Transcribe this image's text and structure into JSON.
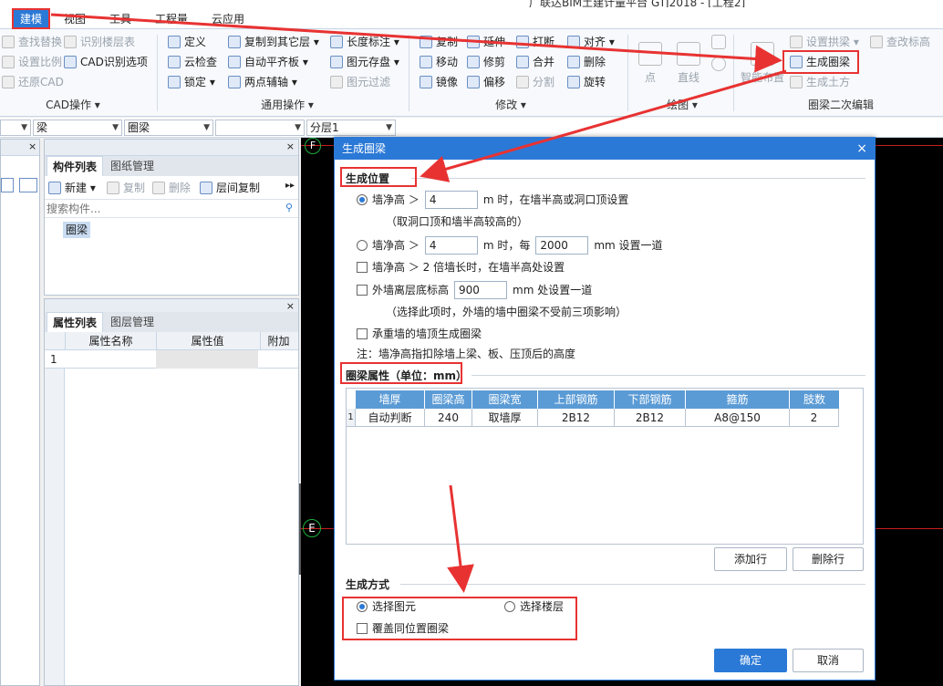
{
  "app": {
    "title": "广联达BIM土建计量平台 GTJ2018 - [工程2]"
  },
  "menu": {
    "items": [
      "建模",
      "视图",
      "工具",
      "工程量",
      "云应用"
    ]
  },
  "ribbon": {
    "cad": {
      "items": [
        "查找替换",
        "识别楼层表",
        "设置比例",
        "CAD识别选项",
        "还原CAD"
      ],
      "group": "CAD操作 ▾"
    },
    "common": {
      "items": [
        "定义",
        "复制到其它层 ▾",
        "长度标注 ▾",
        "云检查",
        "自动平齐板 ▾",
        "图元存盘 ▾",
        "锁定 ▾",
        "两点辅轴 ▾",
        "图元过滤"
      ],
      "group": "通用操作 ▾"
    },
    "modify": {
      "items": [
        "复制",
        "延伸",
        "打断",
        "对齐 ▾",
        "移动",
        "修剪",
        "合并",
        "删除",
        "镜像",
        "偏移",
        "分割",
        "旋转"
      ],
      "group": "修改 ▾"
    },
    "draw": {
      "items": [
        "点",
        "直线"
      ],
      "group": "绘图 ▾"
    },
    "ringbeam": {
      "items": [
        "智能布置",
        "设置拱梁 ▾",
        "查改标高",
        "生成圈梁",
        "生成土方"
      ],
      "group": "圈梁二次编辑"
    }
  },
  "combos": [
    "",
    "梁",
    "圈梁",
    "",
    "分层1"
  ],
  "left": {
    "comp_tabs": [
      "构件列表",
      "图纸管理"
    ],
    "comp_toolbar": [
      "新建 ▾",
      "复制",
      "删除",
      "层间复制"
    ],
    "search_placeholder": "搜索构件...",
    "comp_item": "圈梁",
    "prop_tabs": [
      "属性列表",
      "图层管理"
    ],
    "prop_headers": [
      "属性名称",
      "属性值",
      "附加"
    ],
    "prop_row_no": "1"
  },
  "canvas": {
    "axis_f": "F",
    "axis_e": "E"
  },
  "dialog": {
    "title": "生成圈梁",
    "close": "×",
    "position": {
      "section": "生成位置",
      "opt1_a": "墙净高 ＞",
      "opt1_value": "4",
      "opt1_b": "m 时，在墙半高或洞口顶设置",
      "opt1_note": "（取洞口顶和墙半高较高的）",
      "opt2_a": "墙净高 ＞",
      "opt2_value": "4",
      "opt2_b": "m 时，每",
      "opt2_value2": "2000",
      "opt2_c": "mm 设置一道",
      "opt3": "墙净高 ＞ 2 倍墙长时，在墙半高处设置",
      "opt4_a": "外墙离层底标高",
      "opt4_value": "900",
      "opt4_b": "mm 处设置一道",
      "opt4_note": "（选择此项时，外墙的墙中圈梁不受前三项影响）",
      "opt5": "承重墙的墙顶生成圈梁",
      "note": "注：墙净高指扣除墙上梁、板、压顶后的高度"
    },
    "props": {
      "section": "圈梁属性（单位：mm）",
      "headers": [
        "墙厚",
        "圈梁高",
        "圈梁宽",
        "上部钢筋",
        "下部钢筋",
        "箍筋",
        "肢数"
      ],
      "row_no": "1",
      "row": [
        "自动判断",
        "240",
        "取墙厚",
        "2B12",
        "2B12",
        "A8@150",
        "2"
      ]
    },
    "add_row": "添加行",
    "del_row": "删除行",
    "method": {
      "section": "生成方式",
      "opt1": "选择图元",
      "opt2": "选择楼层",
      "override": "覆盖同位置圈梁"
    },
    "ok": "确定",
    "cancel": "取消"
  },
  "colors": {
    "accent": "#2b79d6",
    "annotation": "#e83232",
    "table_header": "#5b9bd5"
  }
}
